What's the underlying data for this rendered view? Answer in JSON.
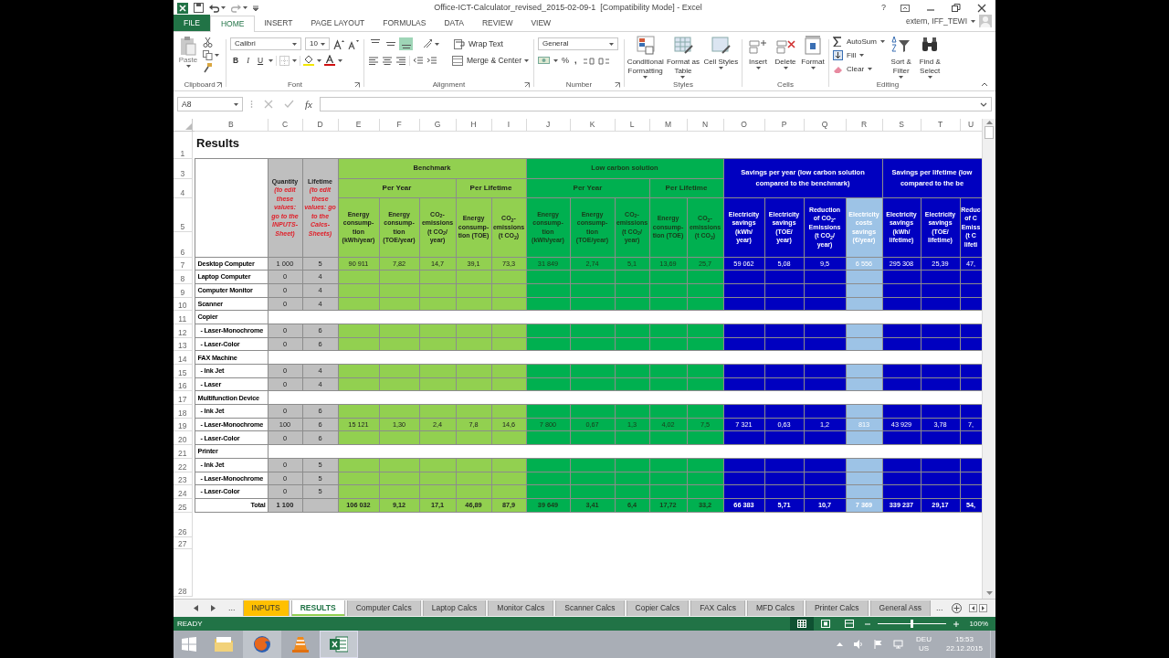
{
  "title_bar": {
    "title": "Office-ICT-Calculator_revised_2015-02-09-1  [Compatibility Mode] - Excel",
    "help": "?",
    "account": "extern, IFF_TEWI"
  },
  "ribbon_tabs": [
    {
      "label": "FILE",
      "kind": "file",
      "selected": false
    },
    {
      "label": "HOME",
      "kind": "tab",
      "selected": true
    },
    {
      "label": "INSERT",
      "kind": "tab",
      "selected": false
    },
    {
      "label": "PAGE LAYOUT",
      "kind": "tab",
      "selected": false
    },
    {
      "label": "FORMULAS",
      "kind": "tab",
      "selected": false
    },
    {
      "label": "DATA",
      "kind": "tab",
      "selected": false
    },
    {
      "label": "REVIEW",
      "kind": "tab",
      "selected": false
    },
    {
      "label": "VIEW",
      "kind": "tab",
      "selected": false
    }
  ],
  "ribbon": {
    "clipboard": {
      "paste": "Paste",
      "label": "Clipboard"
    },
    "font": {
      "name": "Calibri",
      "size": "10",
      "bold": "B",
      "italic": "I",
      "underline": "U",
      "label": "Font"
    },
    "alignment": {
      "vertical": [
        {
          "selected": false
        },
        {
          "selected": false
        },
        {
          "selected": true
        }
      ],
      "wrap": "Wrap Text",
      "merge": "Merge & Center",
      "label": "Alignment"
    },
    "number": {
      "format": "General",
      "percent": "%",
      "comma": ",",
      "label": "Number"
    },
    "styles": {
      "buttons": [
        "Conditional Formatting",
        "Format as Table",
        "Cell Styles"
      ],
      "label": "Styles"
    },
    "cells": {
      "buttons": [
        "Insert",
        "Delete",
        "Format"
      ],
      "label": "Cells"
    },
    "editing": {
      "small": [
        "AutoSum",
        "Fill",
        "Clear"
      ],
      "large": [
        "Sort & Filter",
        "Find & Select"
      ],
      "label": "Editing"
    }
  },
  "formula_bar": {
    "name_box": "A8",
    "fx": "fx"
  },
  "sheet": {
    "columns": [
      "B",
      "C",
      "D",
      "E",
      "F",
      "G",
      "H",
      "I",
      "J",
      "K",
      "L",
      "M",
      "N",
      "O",
      "P",
      "Q",
      "R",
      "S",
      "T",
      "U"
    ],
    "title_row": {
      "number": "1",
      "text": "Results"
    },
    "header_rows": [
      "3",
      "4",
      "5",
      "6"
    ],
    "header": {
      "quantity": {
        "title": "Quantity",
        "note": [
          "(to edit",
          "these",
          "values:",
          "go to the",
          "INPUTS-",
          "Sheet)"
        ]
      },
      "lifetime": {
        "title": "Lifetime",
        "note": [
          "(to edit",
          "these",
          "values: go",
          "to the",
          "Calcs-",
          "Sheets)"
        ]
      },
      "groups": [
        {
          "lines": [
            "Benchmark"
          ],
          "kind": "light",
          "subgroups": [
            {
              "title": "Per Year",
              "columns": [
                {
                  "lines": [
                    "Energy",
                    "consump-",
                    "tion",
                    "(kWh/year)"
                  ]
                },
                {
                  "lines": [
                    "Energy",
                    "consump-",
                    "tion",
                    "(TOE/year)"
                  ]
                },
                {
                  "lines": [
                    "CO$_{2}$-",
                    "emissions",
                    "(t CO$_{2}$/",
                    "year)"
                  ]
                }
              ]
            },
            {
              "title": "Per Lifetime",
              "columns": [
                {
                  "lines": [
                    "Energy",
                    "consump-",
                    "tion (TOE)"
                  ]
                },
                {
                  "lines": [
                    "CO$_{2}$-",
                    "emissions",
                    "(t CO$_{2}$)"
                  ]
                }
              ]
            }
          ]
        },
        {
          "lines": [
            "Low carbon solution"
          ],
          "kind": "green",
          "subgroups": [
            {
              "title": "Per Year",
              "columns": [
                {
                  "lines": [
                    "Energy",
                    "consump-",
                    "tion",
                    "(kWh/year)"
                  ]
                },
                {
                  "lines": [
                    "Energy",
                    "consump-",
                    "tion",
                    "(TOE/year)"
                  ]
                },
                {
                  "lines": [
                    "CO$_{2}$-",
                    "emissions",
                    "(t CO$_{2}$/",
                    "year)"
                  ]
                }
              ]
            },
            {
              "title": "Per Lifetime",
              "columns": [
                {
                  "lines": [
                    "Energy",
                    "consump-",
                    "tion (TOE)"
                  ]
                },
                {
                  "lines": [
                    "CO$_{2}$-",
                    "emissions",
                    "(t CO$_{2}$)"
                  ]
                }
              ]
            }
          ]
        },
        {
          "lines": [
            "Savings per year (low carbon solution",
            "compared to the benchmark)"
          ],
          "kind": "blue",
          "columns": [
            {
              "lines": [
                "Electricity",
                "savings",
                "(kWh/",
                "year)"
              ]
            },
            {
              "lines": [
                "Electricity",
                "savings",
                "(TOE/",
                "year)"
              ]
            },
            {
              "lines": [
                "Reduction",
                "of CO$_{2}$-",
                "Emissions",
                "(t CO$_{2}$/",
                "year)"
              ]
            },
            {
              "lines": [
                "Electricity",
                "costs",
                "savings",
                "(€/year)"
              ],
              "kind": "pale"
            }
          ]
        },
        {
          "lines": [
            "Savings per lifetime (low",
            "compared to the be"
          ],
          "kind": "blue",
          "columns": [
            {
              "lines": [
                "Electricity",
                "savings",
                "(kWh/",
                "lifetime)"
              ]
            },
            {
              "lines": [
                "Electricity",
                "savings",
                "(TOE/",
                "lifetime)"
              ]
            },
            {
              "lines": [
                "Reduc",
                "of C",
                "Emiss",
                "(t C",
                "lifeti"
              ]
            }
          ]
        }
      ]
    },
    "rows": [
      {
        "number": "7",
        "kind": "item",
        "label": "Desktop Computer",
        "quantity": "1 000",
        "lifetime": "5",
        "values": [
          "90 911",
          "7,82",
          "14,7",
          "39,1",
          "73,3",
          "31 849",
          "2,74",
          "5,1",
          "13,69",
          "25,7",
          "59 062",
          "5,08",
          "9,5",
          "6 556",
          "295 308",
          "25,39",
          "47,"
        ]
      },
      {
        "number": "8",
        "kind": "item",
        "label": "Laptop Computer",
        "quantity": "0",
        "lifetime": "4"
      },
      {
        "number": "9",
        "kind": "item",
        "label": "Computer Monitor",
        "quantity": "0",
        "lifetime": "4"
      },
      {
        "number": "10",
        "kind": "item",
        "label": "Scanner",
        "quantity": "0",
        "lifetime": "4"
      },
      {
        "number": "11",
        "kind": "group",
        "label": "Copier"
      },
      {
        "number": "12",
        "kind": "item",
        "label": "- Laser-Monochrome",
        "quantity": "0",
        "lifetime": "6"
      },
      {
        "number": "13",
        "kind": "item",
        "label": "- Laser-Color",
        "quantity": "0",
        "lifetime": "6"
      },
      {
        "number": "14",
        "kind": "group",
        "label": "FAX Machine"
      },
      {
        "number": "15",
        "kind": "item",
        "label": "- Ink Jet",
        "quantity": "0",
        "lifetime": "4"
      },
      {
        "number": "16",
        "kind": "item",
        "label": "- Laser",
        "quantity": "0",
        "lifetime": "4"
      },
      {
        "number": "17",
        "kind": "group",
        "label": "Multifunction Device"
      },
      {
        "number": "18",
        "kind": "item",
        "label": "- Ink Jet",
        "quantity": "0",
        "lifetime": "6"
      },
      {
        "number": "19",
        "kind": "item",
        "label": "- Laser-Monochrome",
        "quantity": "100",
        "lifetime": "6",
        "values": [
          "15 121",
          "1,30",
          "2,4",
          "7,8",
          "14,6",
          "7 800",
          "0,67",
          "1,3",
          "4,02",
          "7,5",
          "7 321",
          "0,63",
          "1,2",
          "813",
          "43 929",
          "3,78",
          "7,"
        ]
      },
      {
        "number": "20",
        "kind": "item",
        "label": "- Laser-Color",
        "quantity": "0",
        "lifetime": "6"
      },
      {
        "number": "21",
        "kind": "group",
        "label": "Printer"
      },
      {
        "number": "22",
        "kind": "item",
        "label": "- Ink Jet",
        "quantity": "0",
        "lifetime": "5"
      },
      {
        "number": "23",
        "kind": "item",
        "label": "- Laser-Monochrome",
        "quantity": "0",
        "lifetime": "5"
      },
      {
        "number": "24",
        "kind": "item",
        "label": "- Laser-Color",
        "quantity": "0",
        "lifetime": "5"
      },
      {
        "number": "25",
        "kind": "total",
        "label": "Total",
        "quantity": "1 100",
        "values": [
          "106 032",
          "9,12",
          "17,1",
          "46,89",
          "87,9",
          "39 649",
          "3,41",
          "6,4",
          "17,72",
          "33,2",
          "66 383",
          "5,71",
          "10,7",
          "7 369",
          "339 237",
          "29,17",
          "54,"
        ]
      }
    ],
    "empty_rows": [
      "26",
      "27",
      "28"
    ]
  },
  "sheet_tabs": {
    "more_left": "...",
    "tabs": [
      {
        "label": "INPUTS",
        "color": "#ffc000",
        "selected": false
      },
      {
        "label": "RESULTS",
        "color": "#92d050",
        "selected": true
      },
      {
        "label": "Computer Calcs",
        "color": "#c8c8c8",
        "selected": false
      },
      {
        "label": "Laptop Calcs",
        "color": "#c8c8c8",
        "selected": false
      },
      {
        "label": "Monitor Calcs",
        "color": "#c8c8c8",
        "selected": false
      },
      {
        "label": "Scanner Calcs",
        "color": "#c8c8c8",
        "selected": false
      },
      {
        "label": "Copier Calcs",
        "color": "#c8c8c8",
        "selected": false
      },
      {
        "label": "FAX Calcs",
        "color": "#c8c8c8",
        "selected": false
      },
      {
        "label": "MFD Calcs",
        "color": "#c8c8c8",
        "selected": false
      },
      {
        "label": "Printer Calcs",
        "color": "#c8c8c8",
        "selected": false
      },
      {
        "label": "General Ass",
        "color": "#c8c8c8",
        "selected": false
      }
    ],
    "more_right": "..."
  },
  "status_bar": {
    "mode": "READY",
    "zoom": {
      "level": 0.5,
      "reading": "100%"
    }
  },
  "taskbar": {
    "language": "DEU",
    "layout": "US",
    "time": "15:53",
    "date": "22.12.2015"
  }
}
